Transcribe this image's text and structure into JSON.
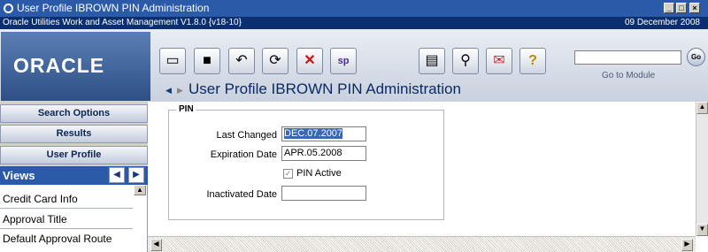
{
  "window": {
    "title": "User Profile IBROWN PIN Administration",
    "controls": [
      "_",
      "□",
      "×"
    ]
  },
  "subbar": {
    "app_version": "Oracle Utilities Work and Asset Management V1.8.0 {v18-10}",
    "date": "09 December  2008"
  },
  "header": {
    "logo": "ORACLE",
    "page_title": "User Profile IBROWN PIN Administration",
    "go_label": "Go to Module",
    "go_button": "Go",
    "go_input_value": ""
  },
  "toolbar": {
    "icons": [
      "new-document-icon",
      "save-icon",
      "undo-icon",
      "refresh-icon",
      "delete-icon",
      "spell-check-icon",
      "report-icon",
      "attachments-icon",
      "log-icon",
      "help-icon"
    ],
    "spell_glyph": "sp"
  },
  "sidebar": {
    "search_options": "Search Options",
    "results": "Results",
    "user_profile": "User Profile",
    "views_title": "Views",
    "views_items": [
      "Credit Card Info",
      "Approval Title",
      "Default Approval Route"
    ]
  },
  "form": {
    "legend": "PIN",
    "last_changed_label": "Last Changed",
    "last_changed_value": "DEC.07.2007",
    "expiration_label": "Expiration Date",
    "expiration_value": "APR.05.2008",
    "pin_active_label": "PIN Active",
    "pin_active_checked": true,
    "inactivated_label": "Inactivated Date",
    "inactivated_value": ""
  },
  "colors": {
    "titlebar": "#2a5aa8",
    "subbar": "#0a2f6e",
    "selection": "#3a67b5"
  }
}
